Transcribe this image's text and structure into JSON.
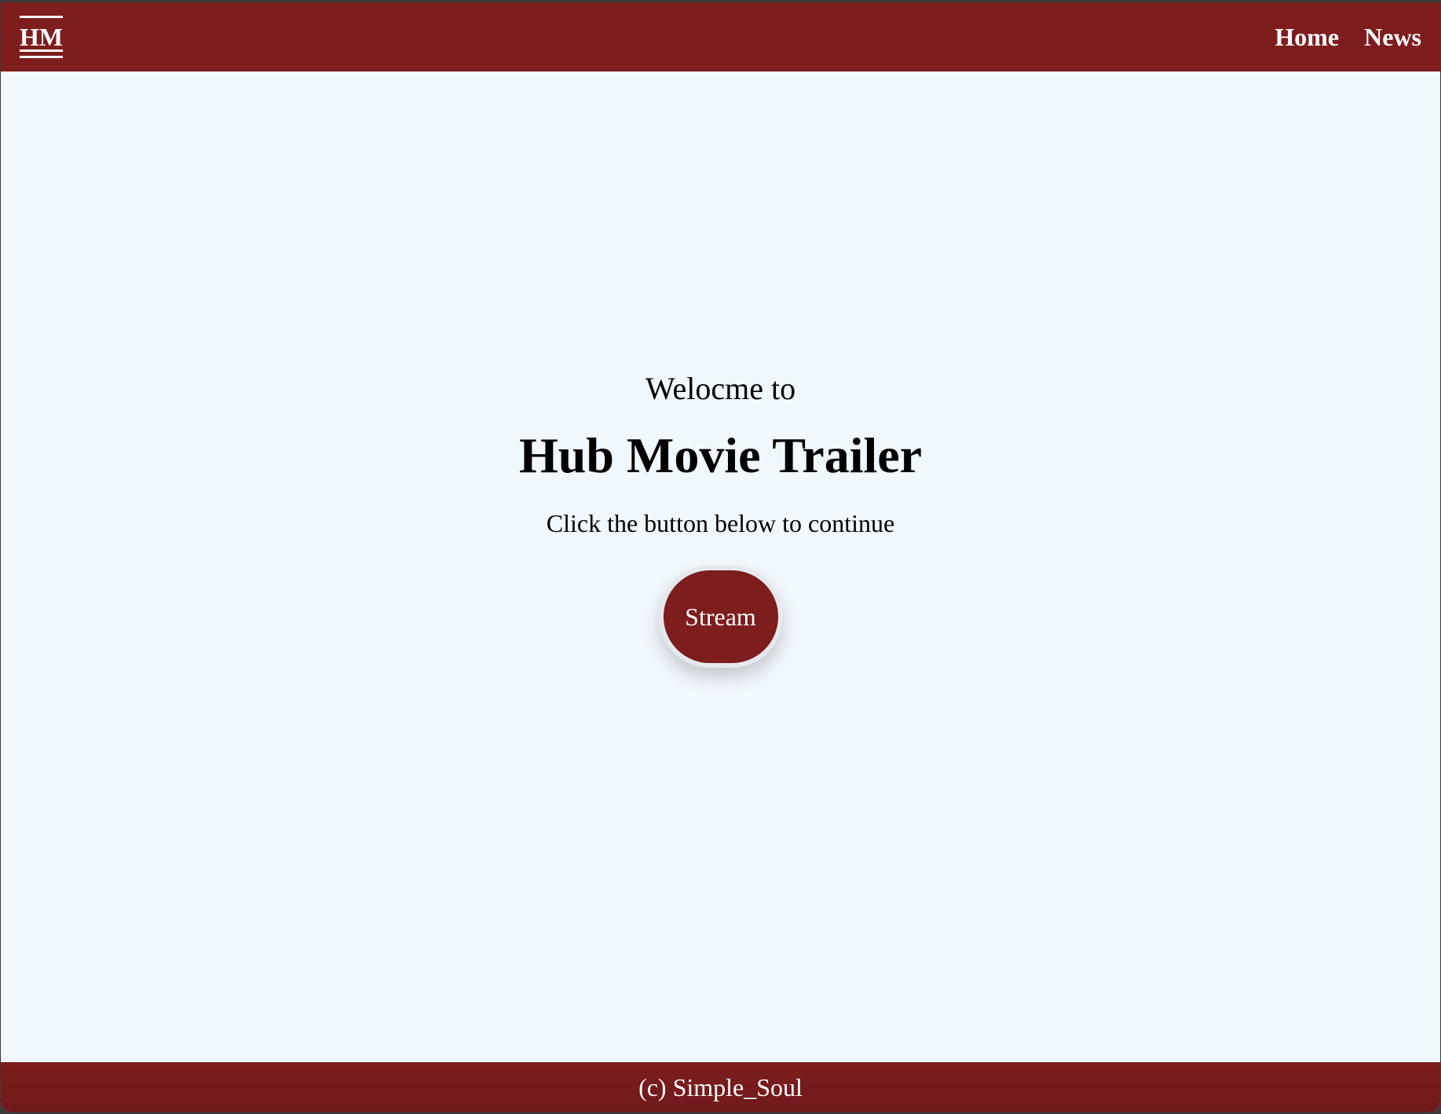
{
  "navbar": {
    "logo": "HM",
    "links": [
      "Home",
      "News"
    ]
  },
  "main": {
    "welcome": "Welocme to",
    "title": "Hub Movie Trailer",
    "subtitle": "Click the button below to continue",
    "button_label": "Stream"
  },
  "footer": {
    "copyright": "(c) Simple_Soul"
  },
  "colors": {
    "brand": "#7d1d1e",
    "background": "#f0f7fd",
    "text": "#000000",
    "nav_text": "#ffffff"
  }
}
